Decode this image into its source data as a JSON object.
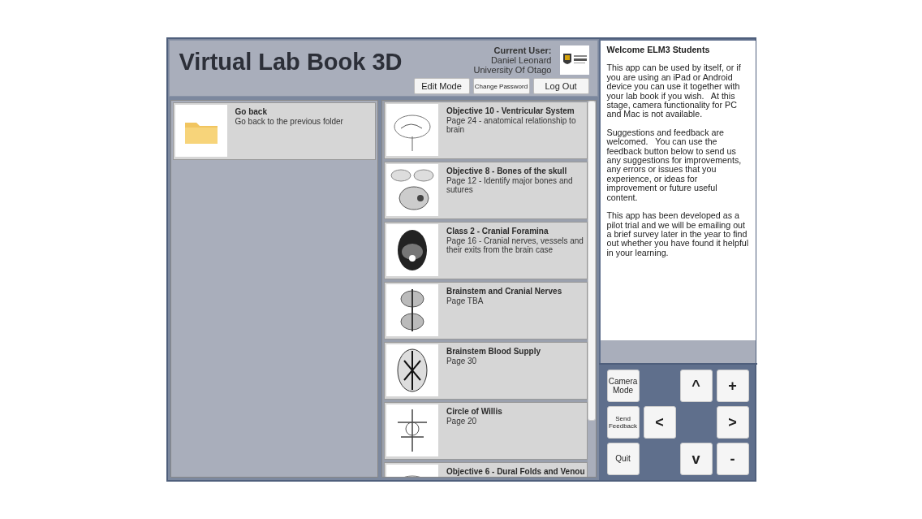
{
  "header": {
    "title": "Virtual Lab Book 3D",
    "user_label": "Current User:",
    "user_name": "Daniel Leonard",
    "institution": "University Of Otago",
    "buttons": [
      {
        "label": "Edit Mode",
        "kind": "normal"
      },
      {
        "label": "Change Password",
        "kind": "small"
      },
      {
        "label": "Log Out",
        "kind": "normal"
      }
    ]
  },
  "folder": {
    "title": "Go back",
    "subtitle": "Go back to the previous folder"
  },
  "items": [
    {
      "title": "Objective 10 - Ventricular System",
      "subtitle": "Page 24 - anatomical relationship to brain"
    },
    {
      "title": "Objective 8 - Bones of the skull",
      "subtitle": "Page 12 - Identify major bones and sutures"
    },
    {
      "title": "Class 2 - Cranial Foramina",
      "subtitle": "Page 16 - Cranial nerves, vessels and their exits from the brain case"
    },
    {
      "title": "Brainstem and Cranial Nerves",
      "subtitle": "Page TBA"
    },
    {
      "title": "Brainstem Blood Supply",
      "subtitle": "Page 30"
    },
    {
      "title": "Circle of Willis",
      "subtitle": "Page 20"
    },
    {
      "title": "Objective 6 - Dural Folds and Venou"
    }
  ],
  "info": {
    "heading": "Welcome ELM3 Students",
    "paragraphs": [
      "This app can be used by itself, or if you are using an iPad or Android device you can use it together with your lab book if you wish.   At this stage, camera functionality for PC and Mac is not available.",
      "Suggestions and feedback are welcomed.   You can use the feedback button below to send us any suggestions for improvements, any errors or issues that you experience, or ideas for improvement or future useful content.",
      "This app has been developed as a pilot trial and we will be emailing out a brief survey later in the year to find out whether you have found it helpful in your learning."
    ]
  },
  "controls": [
    [
      {
        "kind": "text",
        "label": "Camera Mode"
      },
      {
        "kind": "blank"
      },
      {
        "kind": "symbol",
        "label": "^"
      },
      {
        "kind": "symbol",
        "label": "+"
      }
    ],
    [
      {
        "kind": "small",
        "label": "Send Feedback"
      },
      {
        "kind": "symbol",
        "label": "<"
      },
      {
        "kind": "blank"
      },
      {
        "kind": "symbol",
        "label": ">"
      }
    ],
    [
      {
        "kind": "text",
        "label": "Quit"
      },
      {
        "kind": "blank"
      },
      {
        "kind": "symbol",
        "label": "v"
      },
      {
        "kind": "symbol",
        "label": "-"
      }
    ]
  ]
}
